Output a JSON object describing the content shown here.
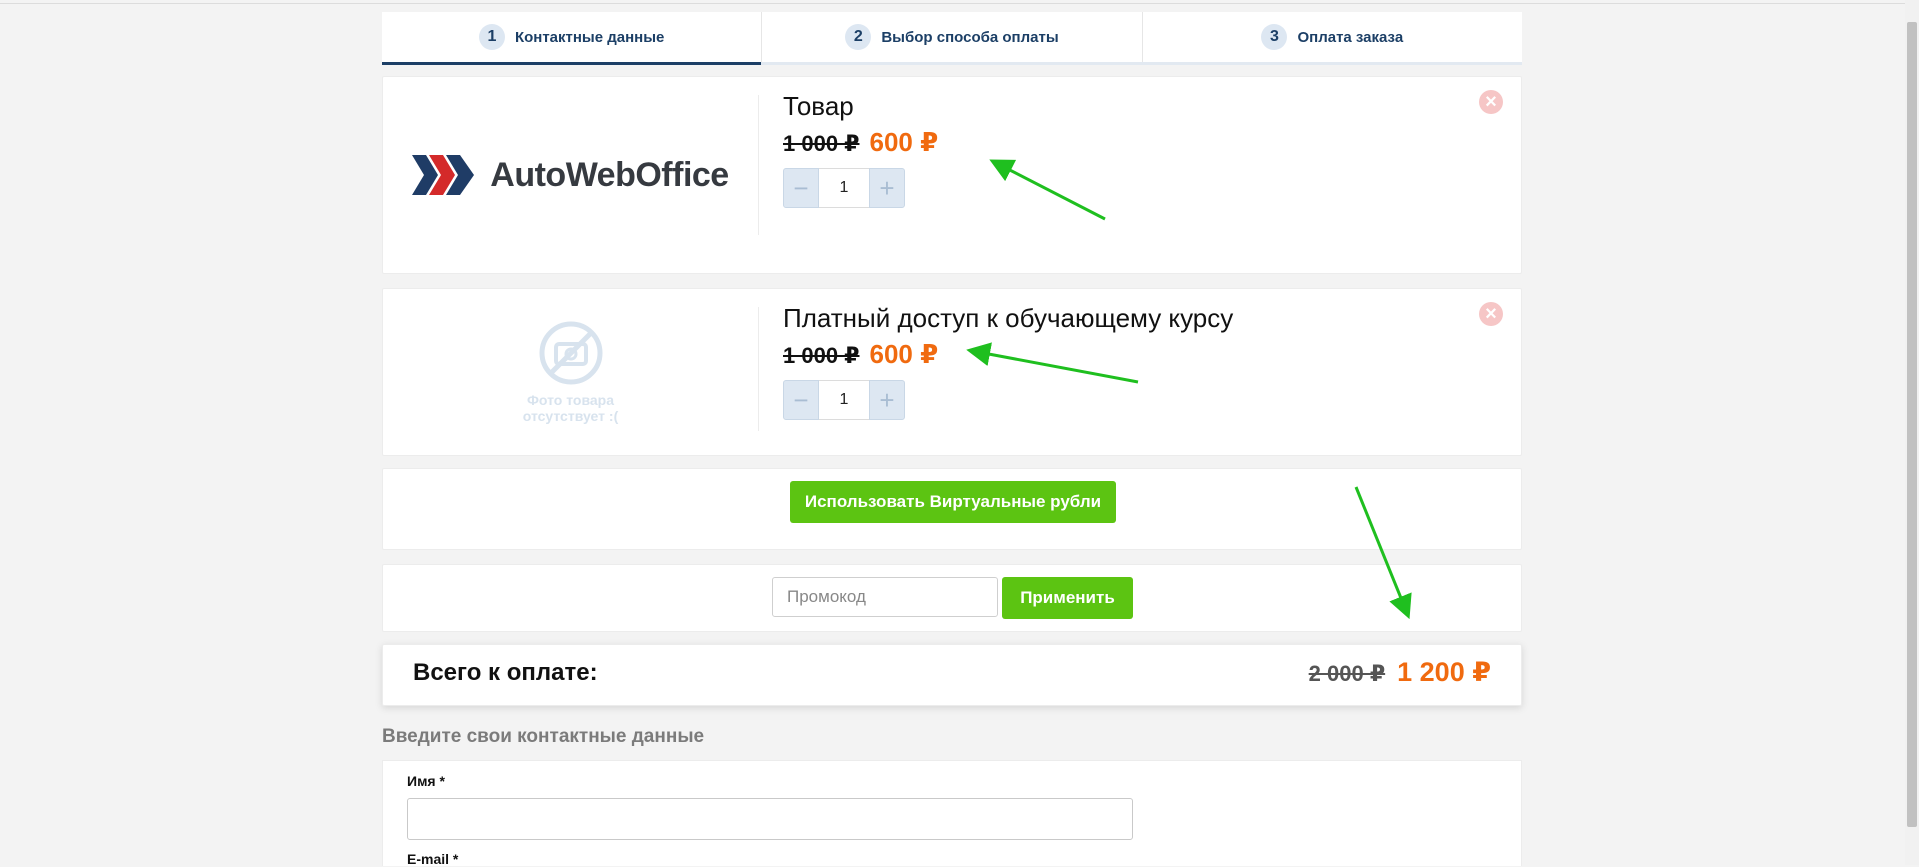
{
  "steps": [
    {
      "number": "1",
      "label": "Контактные данные"
    },
    {
      "number": "2",
      "label": "Выбор способа оплаты"
    },
    {
      "number": "3",
      "label": "Оплата заказа"
    }
  ],
  "products": [
    {
      "name": "Товар",
      "old_price": "1 000 ₽",
      "new_price": "600 ₽",
      "quantity": "1",
      "image_logo_text": "AutoWebOffice"
    },
    {
      "name": "Платный доступ к обучающему курсу",
      "old_price": "1 000 ₽",
      "new_price": "600 ₽",
      "quantity": "1",
      "no_photo_text": "Фото товара отсутствует :("
    }
  ],
  "virtual_rubles_button": "Использовать Виртуальные рубли",
  "promo": {
    "placeholder": "Промокод",
    "apply_label": "Применить"
  },
  "total": {
    "label": "Всего к оплате:",
    "old": "2 000 ₽",
    "new": "1 200 ₽"
  },
  "contact_section_title": "Введите свои контактные данные",
  "form": {
    "name_label": "Имя *",
    "email_label": "E-mail *"
  },
  "colors": {
    "accent_orange": "#f06a0f",
    "green": "#5cc412",
    "navy": "#1c3f66",
    "annotation_arrow": "#1fbf1f"
  },
  "icons": [
    "close-icon",
    "minus-icon",
    "plus-icon",
    "no-photo-icon",
    "autowebofficelogo-chevrons-icon"
  ]
}
